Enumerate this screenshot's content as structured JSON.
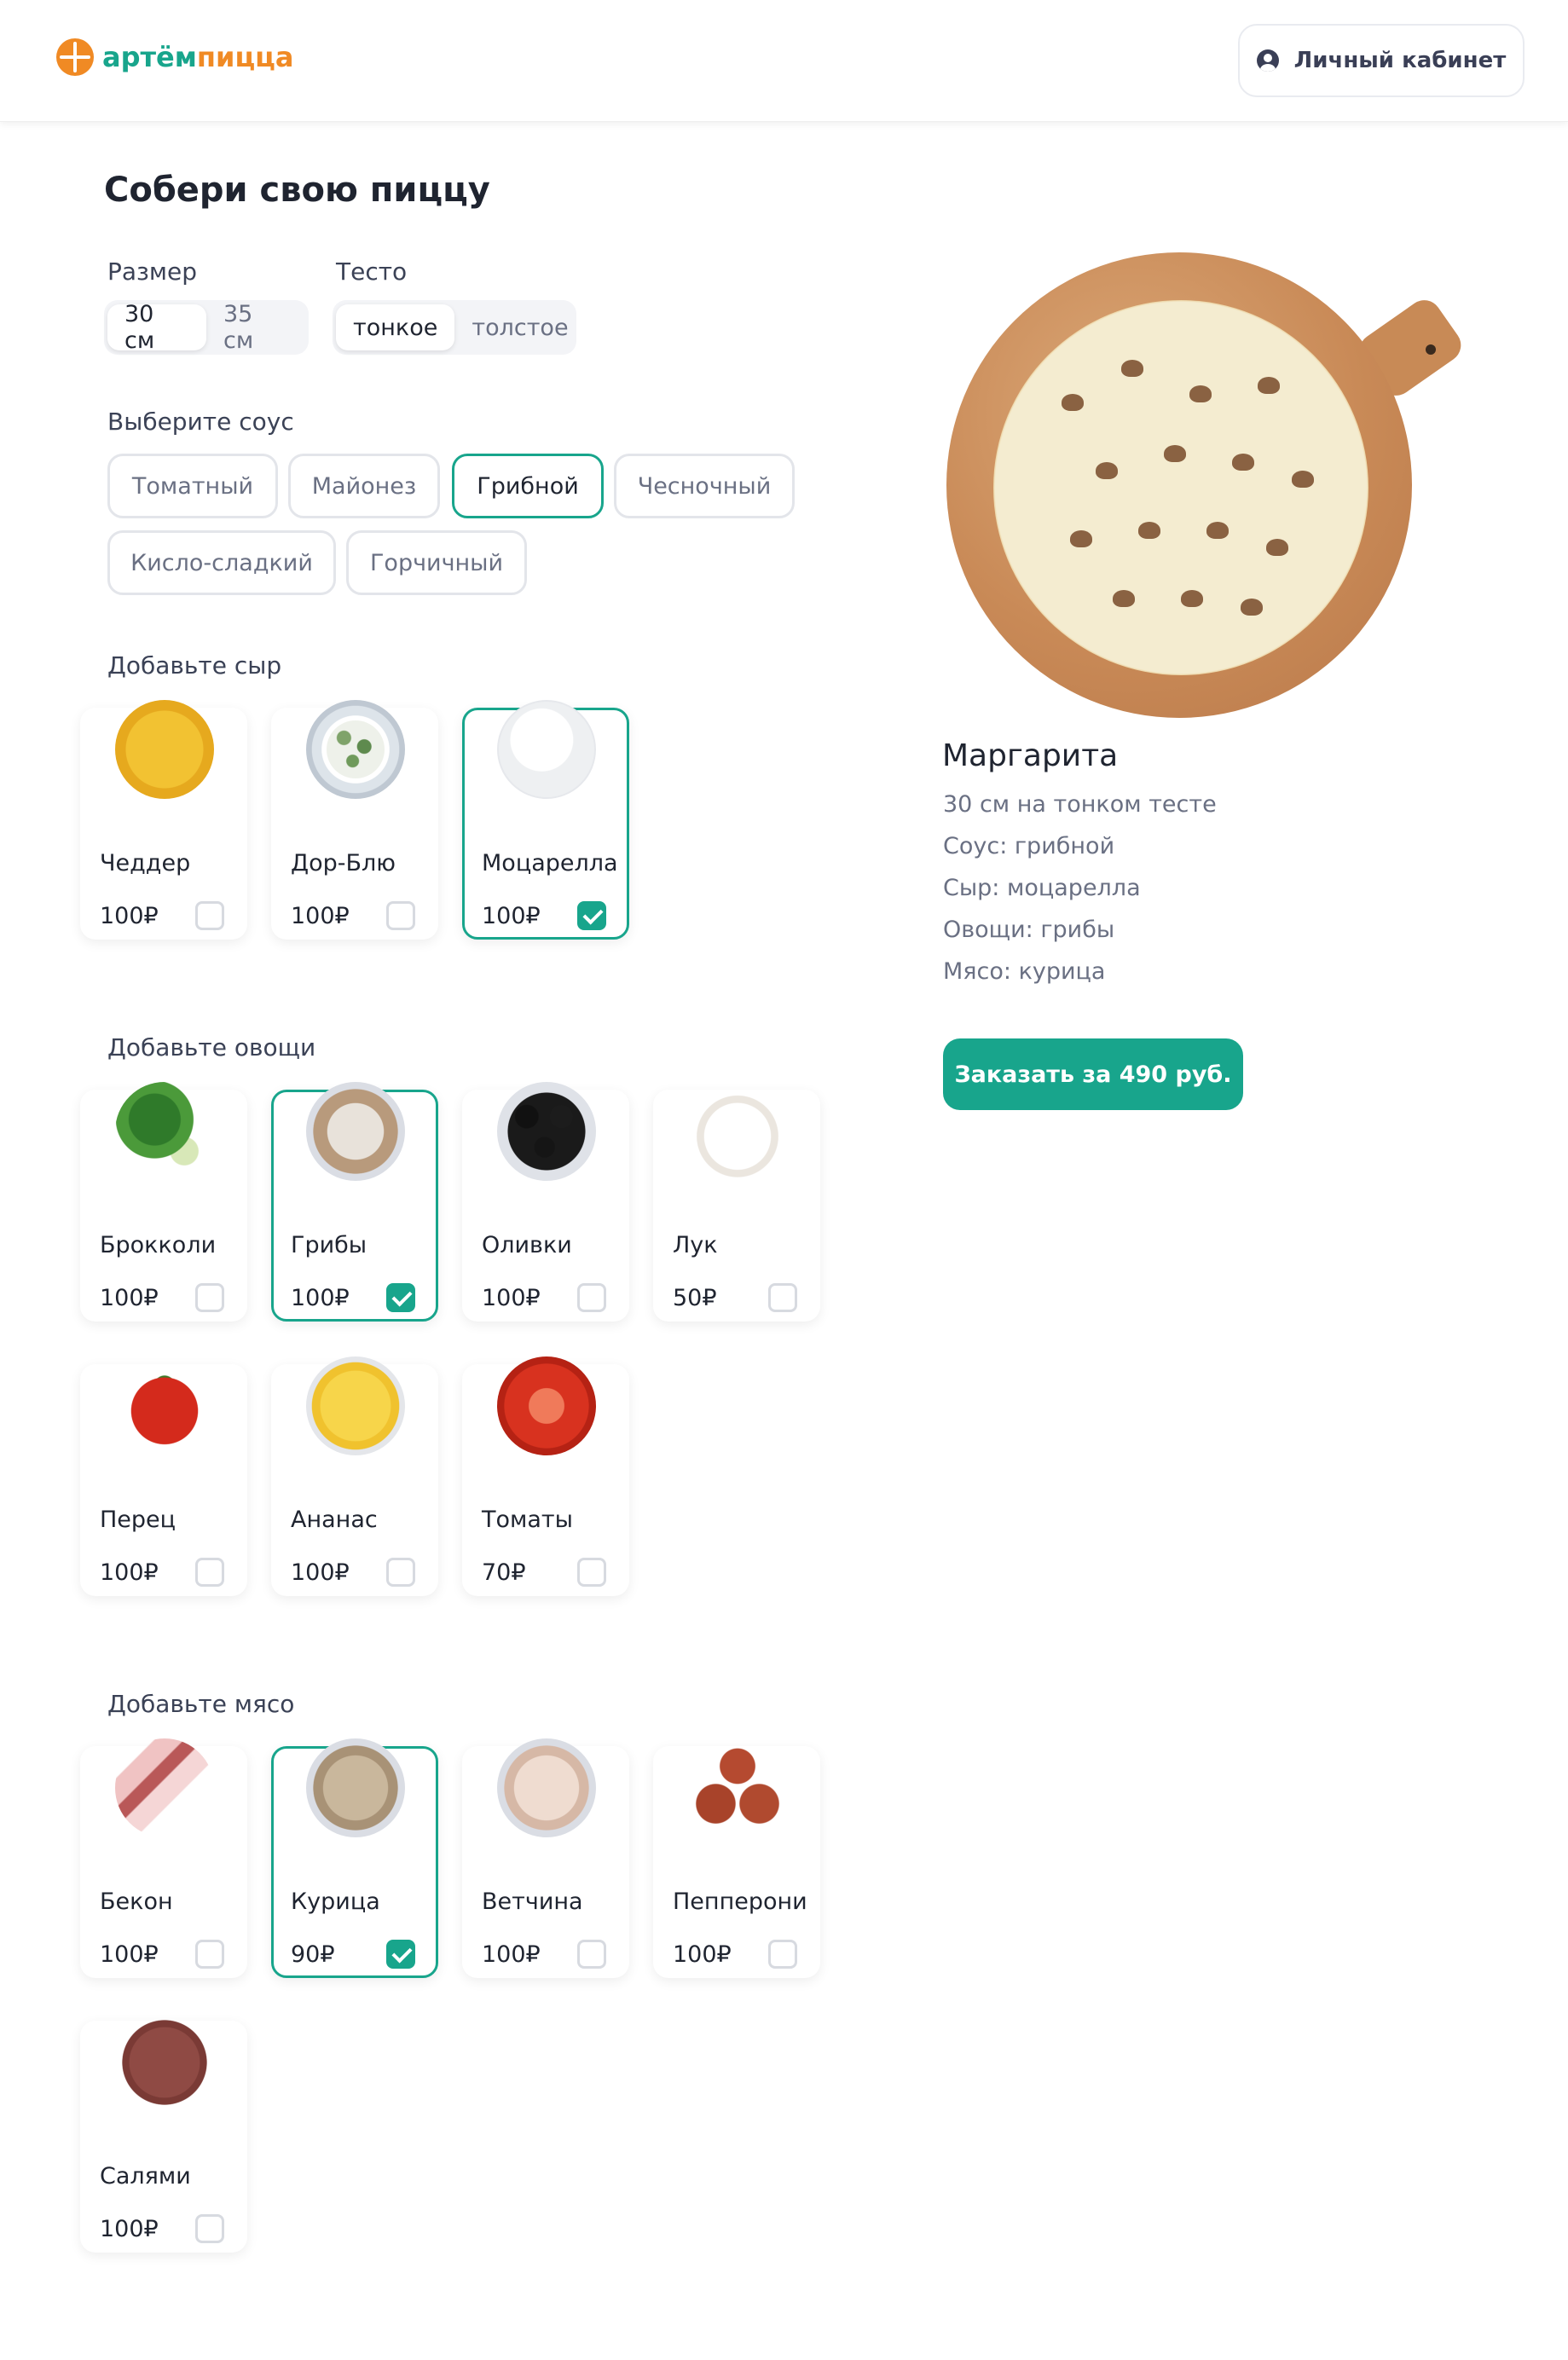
{
  "header": {
    "logo_part1": "артём",
    "logo_part2": "пицца",
    "cabinet_label": "Личный кабинет"
  },
  "builder": {
    "title": "Собери свою пиццу",
    "size": {
      "label": "Размер",
      "options": [
        "30 см",
        "35 см"
      ],
      "selected": "30 см"
    },
    "dough": {
      "label": "Тесто",
      "options": [
        "тонкое",
        "толстое"
      ],
      "selected": "тонкое"
    },
    "sauce": {
      "label": "Выберите соус",
      "options": [
        "Томатный",
        "Майонез",
        "Грибной",
        "Чесночный",
        "Кисло-сладкий",
        "Горчичный"
      ],
      "selected": "Грибной"
    },
    "cheese": {
      "label": "Добавьте сыр",
      "items": [
        {
          "name": "Чеддер",
          "price": "100₽",
          "checked": false,
          "image": "cheddar"
        },
        {
          "name": "Дор-Блю",
          "price": "100₽",
          "checked": false,
          "image": "dorblue"
        },
        {
          "name": "Моцарелла",
          "price": "100₽",
          "checked": true,
          "image": "mozzarella"
        }
      ]
    },
    "vegetables": {
      "label": "Добавьте овощи",
      "items": [
        {
          "name": "Брокколи",
          "price": "100₽",
          "checked": false,
          "image": "broccoli"
        },
        {
          "name": "Грибы",
          "price": "100₽",
          "checked": true,
          "image": "mushrooms"
        },
        {
          "name": "Оливки",
          "price": "100₽",
          "checked": false,
          "image": "olives"
        },
        {
          "name": "Лук",
          "price": "50₽",
          "checked": false,
          "image": "onion"
        },
        {
          "name": "Перец",
          "price": "100₽",
          "checked": false,
          "image": "pepper"
        },
        {
          "name": "Ананас",
          "price": "100₽",
          "checked": false,
          "image": "pineapple"
        },
        {
          "name": "Томаты",
          "price": "70₽",
          "checked": false,
          "image": "tomato"
        }
      ]
    },
    "meat": {
      "label": "Добавьте мясо",
      "items": [
        {
          "name": "Бекон",
          "price": "100₽",
          "checked": false,
          "image": "bacon"
        },
        {
          "name": "Курица",
          "price": "90₽",
          "checked": true,
          "image": "chicken"
        },
        {
          "name": "Ветчина",
          "price": "100₽",
          "checked": false,
          "image": "ham"
        },
        {
          "name": "Пепперони",
          "price": "100₽",
          "checked": false,
          "image": "pepperoni"
        },
        {
          "name": "Салями",
          "price": "100₽",
          "checked": false,
          "image": "salami"
        }
      ]
    }
  },
  "preview": {
    "pizza_name": "Маргарита",
    "summary": [
      "30 см на тонком тесте",
      "Соус: грибной",
      "Сыр: моцарелла",
      "Овощи: грибы",
      "Мясо: курица"
    ],
    "order_label": "Заказать за 490 руб."
  },
  "colors": {
    "accent": "#18a58c",
    "logo_orange": "#f08a24",
    "text_dark": "#1f2430",
    "text_muted": "#6a7083",
    "border": "#e3e5ea"
  }
}
